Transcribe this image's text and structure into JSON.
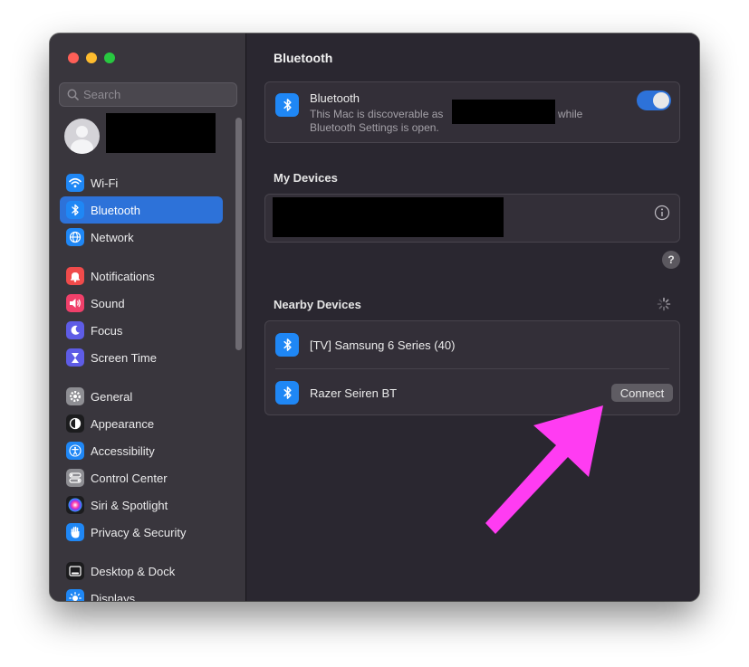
{
  "window": {
    "controls": [
      "close",
      "minimize",
      "zoom"
    ]
  },
  "sidebar": {
    "search_placeholder": "Search",
    "search_icon": "magnifyingglass-icon",
    "groups": [
      [
        {
          "label": "Wi-Fi",
          "icon": "wifi-icon",
          "color": "#1f87f5",
          "active": false
        },
        {
          "label": "Bluetooth",
          "icon": "bluetooth-icon",
          "color": "#1f87f5",
          "active": true
        },
        {
          "label": "Network",
          "icon": "globe-icon",
          "color": "#1f87f5",
          "active": false
        }
      ],
      [
        {
          "label": "Notifications",
          "icon": "bell-icon",
          "color": "#f04b4b",
          "active": false
        },
        {
          "label": "Sound",
          "icon": "speaker-icon",
          "color": "#f0406a",
          "active": false
        },
        {
          "label": "Focus",
          "icon": "moon-icon",
          "color": "#5e5ce6",
          "active": false
        },
        {
          "label": "Screen Time",
          "icon": "hourglass-icon",
          "color": "#5e5ce6",
          "active": false
        }
      ],
      [
        {
          "label": "General",
          "icon": "gear-icon",
          "color": "#8e8e93",
          "active": false
        },
        {
          "label": "Appearance",
          "icon": "appearance-icon",
          "color": "#1c1c1e",
          "active": false
        },
        {
          "label": "Accessibility",
          "icon": "accessibility-icon",
          "color": "#1f87f5",
          "active": false
        },
        {
          "label": "Control Center",
          "icon": "control-center-icon",
          "color": "#8e8e93",
          "active": false
        },
        {
          "label": "Siri & Spotlight",
          "icon": "siri-icon",
          "color": "#b23cd6",
          "active": false
        },
        {
          "label": "Privacy & Security",
          "icon": "hand-icon",
          "color": "#1f87f5",
          "active": false
        }
      ],
      [
        {
          "label": "Desktop & Dock",
          "icon": "dock-icon",
          "color": "#1c1c1e",
          "active": false
        },
        {
          "label": "Displays",
          "icon": "sun-icon",
          "color": "#1f87f5",
          "active": false
        }
      ]
    ]
  },
  "main": {
    "title": "Bluetooth",
    "bluetooth_card": {
      "label": "Bluetooth",
      "desc_prefix": "This Mac is discoverable as",
      "desc_suffix": "while",
      "desc_line2": "Bluetooth Settings is open.",
      "enabled": true
    },
    "my_devices": {
      "title": "My Devices",
      "info_icon": "info-icon"
    },
    "help_label": "?",
    "nearby": {
      "title": "Nearby Devices",
      "spinner_icon": "spinner-icon",
      "devices": [
        {
          "name": "[TV] Samsung 6 Series (40)",
          "action": ""
        },
        {
          "name": "Razer Seiren BT",
          "action": "Connect"
        }
      ]
    }
  },
  "annotation": {
    "color": "#ff3cf2",
    "icon": "arrow-icon"
  }
}
